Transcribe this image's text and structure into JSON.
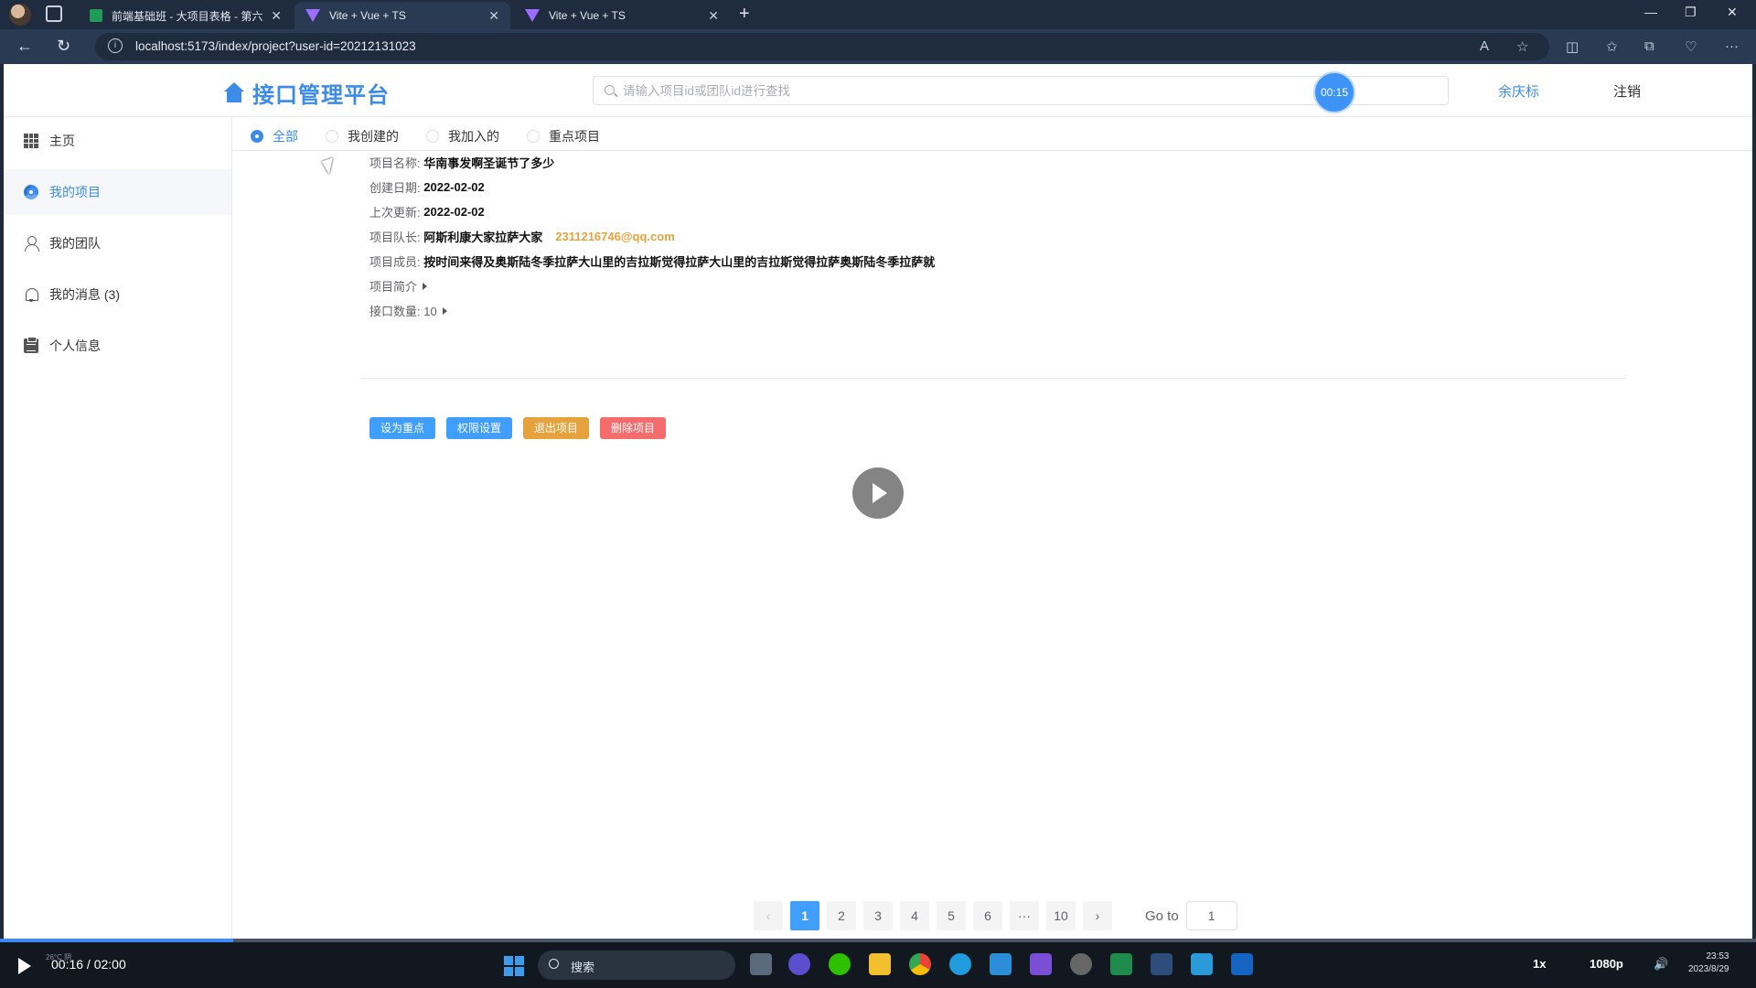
{
  "browser": {
    "tabs": [
      {
        "title": "前端基础班 - 大项目表格 - 第六上",
        "icon": "spreadsheet-icon"
      },
      {
        "title": "Vite + Vue + TS",
        "icon": "vite-icon"
      },
      {
        "title": "Vite + Vue + TS",
        "icon": "vite-icon"
      }
    ],
    "url": "localhost:5173/index/project?user-id=20212131023"
  },
  "app": {
    "title": "接口管理平台",
    "search_placeholder": "请输入项目id或团队id进行查找",
    "timer": "00:15",
    "user_name": "余庆标",
    "logout": "注销"
  },
  "sidebar": {
    "items": [
      {
        "label": "主页",
        "icon": "grid-icon"
      },
      {
        "label": "我的项目",
        "icon": "project-icon"
      },
      {
        "label": "我的团队",
        "icon": "user-icon"
      },
      {
        "label": "我的消息 (3)",
        "icon": "bell-icon"
      },
      {
        "label": "个人信息",
        "icon": "clipboard-icon"
      }
    ],
    "active_index": 1
  },
  "filters": {
    "options": [
      "全部",
      "我创建的",
      "我加入的",
      "重点项目"
    ],
    "selected": "全部"
  },
  "project": {
    "name_label": "项目名称:",
    "name": "华南事发啊圣诞节了多少",
    "created_label": "创建日期:",
    "created": "2022-02-02",
    "updated_label": "上次更新:",
    "updated": "2022-02-02",
    "leader_label": "项目队长:",
    "leader": "阿斯利康大家拉萨大家",
    "leader_email": "2311216746@qq.com",
    "members_label": "项目成员:",
    "members": "按时间来得及奥斯陆冬季拉萨大山里的吉拉斯觉得拉萨大山里的吉拉斯觉得拉萨奥斯陆冬季拉萨就",
    "intro_label": "项目简介",
    "api_count_label": "接口数量: 10",
    "buttons": {
      "favorite": "设为重点",
      "permissions": "权限设置",
      "exit": "退出项目",
      "delete": "删除项目"
    }
  },
  "pagination": {
    "prev": "‹",
    "pages": [
      "1",
      "2",
      "3",
      "4",
      "5",
      "6",
      "···",
      "10"
    ],
    "current": "1",
    "next": "›",
    "goto_label": "Go to",
    "goto_value": "1"
  },
  "player": {
    "time": "00:16 / 02:00",
    "progress": 0.133,
    "speed": "1x",
    "quality": "1080p"
  },
  "taskbar": {
    "search": "搜索",
    "weather": "26°C 阴",
    "clock_time": "23:53",
    "clock_date": "2023/8/29"
  },
  "colors": {
    "accent": "#3c8ce7",
    "primary_button": "#409eff",
    "warning_button": "#e6a23c",
    "danger_button": "#f56c6c"
  }
}
